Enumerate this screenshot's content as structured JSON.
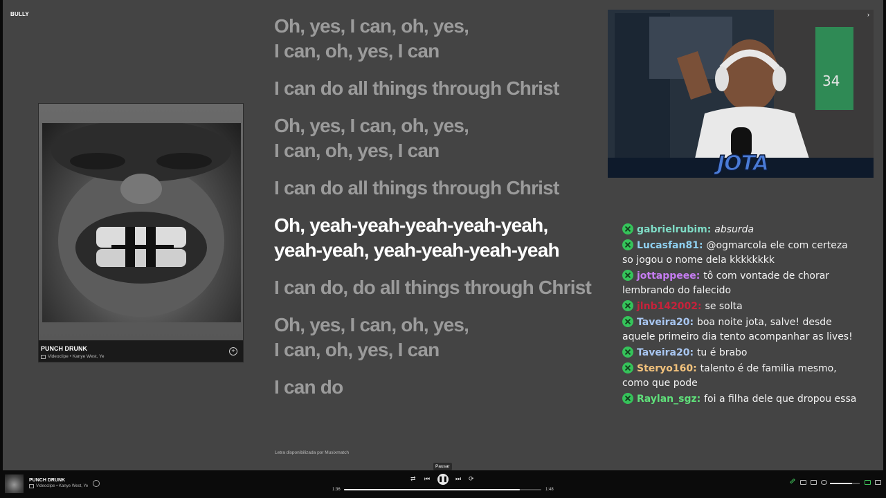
{
  "window": {
    "title": "BULLY"
  },
  "album_card": {
    "title": "PUNCH DRUNK",
    "subtitle": "Videoclipe • Kanye West, Ye",
    "add_icon": "plus-circle-icon"
  },
  "lyrics": {
    "lines": [
      {
        "text": "Oh, yes, I can, oh, yes,\nI can, oh, yes, I can",
        "active": false
      },
      {
        "text": "I can do all things through Christ",
        "active": false
      },
      {
        "text": "Oh, yes, I can, oh, yes,\nI can, oh, yes, I can",
        "active": false
      },
      {
        "text": "I can do all things through Christ",
        "active": false
      },
      {
        "text": "Oh, yeah-yeah-yeah-yeah-yeah,\nyeah-yeah, yeah-yeah-yeah-yeah",
        "active": true
      },
      {
        "text": "I can do, do all things through Christ",
        "active": false
      },
      {
        "text": "Oh, yes, I can, oh, yes,\nI can, oh, yes, I can",
        "active": false
      },
      {
        "text": "I can do",
        "active": false
      }
    ],
    "credit": "Letra disponibilizada por Musixmatch"
  },
  "webcam": {
    "overlay_logo": "JOTA"
  },
  "chat": {
    "messages": [
      {
        "user": "gabrielrubim",
        "color": "#7fdcc6",
        "text": "absurda",
        "italic": true
      },
      {
        "user": "Lucasfan81",
        "color": "#8fd0f0",
        "text": "@ogmarcola ele com certeza so jogou o nome dela kkkkkkkk",
        "italic": false
      },
      {
        "user": "jottappeee",
        "color": "#c57cf0",
        "text": "tô com vontade de chorar lembrando do falecido",
        "italic": false
      },
      {
        "user": "jlnb142002",
        "color": "#c8213a",
        "text": "se solta",
        "italic": false
      },
      {
        "user": "Taveira20",
        "color": "#a9c7f2",
        "text": "boa noite jota, salve! desde aquele primeiro dia tento acompanhar as lives!",
        "italic": false
      },
      {
        "user": "Taveira20",
        "color": "#a9c7f2",
        "text": "tu é brabo",
        "italic": false
      },
      {
        "user": "Steryo160",
        "color": "#f2c27c",
        "text": "talento é de familia mesmo, como que pode",
        "italic": false
      },
      {
        "user": "Raylan_sgz",
        "color": "#5fe07a",
        "text": "foi a filha dele que dropou essa",
        "italic": false
      }
    ]
  },
  "player": {
    "title": "PUNCH DRUNK",
    "subtitle": "Videoclipe • Kanye West, Ye",
    "tooltip": "Pausar",
    "elapsed": "1:36",
    "duration": "1:48",
    "progress": 0.89,
    "volume": 0.75,
    "icons": {
      "shuffle": "shuffle-icon",
      "previous": "previous-icon",
      "play_pause": "pause-icon",
      "next": "next-icon",
      "repeat": "repeat-icon"
    }
  }
}
